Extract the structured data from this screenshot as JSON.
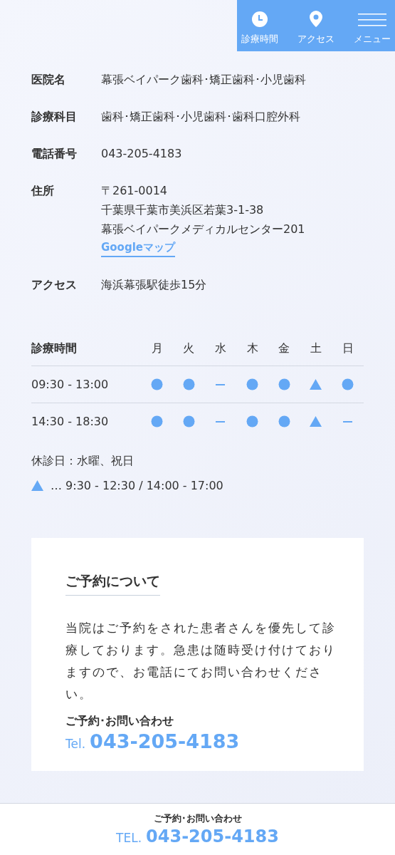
{
  "nav": [
    {
      "kind": "clock",
      "label": "診療時間"
    },
    {
      "kind": "pin",
      "label": "アクセス"
    },
    {
      "kind": "menu",
      "label": "メニュー"
    }
  ],
  "info": [
    {
      "label": "医院名",
      "lines": [
        "幕張ベイパーク歯科･矯正歯科･小児歯科"
      ]
    },
    {
      "label": "診療科目",
      "lines": [
        "歯科･矯正歯科･小児歯科･歯科口腔外科"
      ]
    },
    {
      "label": "電話番号",
      "lines": [
        "043-205-4183"
      ]
    },
    {
      "label": "住所",
      "lines": [
        "〒261-0014",
        "千葉県千葉市美浜区若葉3-1-38",
        "幕張ベイパークメディカルセンター201"
      ],
      "link": "Googleマップ"
    },
    {
      "label": "アクセス",
      "lines": [
        "海浜幕張駅徒歩15分"
      ]
    }
  ],
  "schedule": {
    "heading": "診療時間",
    "days": [
      "月",
      "火",
      "水",
      "木",
      "金",
      "土",
      "日"
    ],
    "rows": [
      {
        "time": "09:30 - 13:00",
        "marks": [
          {
            "kind": "circle"
          },
          {
            "kind": "circle"
          },
          {
            "kind": "dash"
          },
          {
            "kind": "circle"
          },
          {
            "kind": "circle"
          },
          {
            "kind": "triangle"
          },
          {
            "kind": "circle"
          }
        ]
      },
      {
        "time": "14:30 - 18:30",
        "marks": [
          {
            "kind": "circle"
          },
          {
            "kind": "circle"
          },
          {
            "kind": "dash"
          },
          {
            "kind": "circle"
          },
          {
            "kind": "circle"
          },
          {
            "kind": "triangle"
          },
          {
            "kind": "dash"
          }
        ]
      }
    ],
    "closed": "休診日：水曜、祝日",
    "triangle_note": "…  9:30 - 12:30 / 14:00 - 17:00"
  },
  "card": {
    "title": "ご予約について",
    "body": "当院はご予約をされた患者さんを優先して診療しております。急患は随時受け付けておりますので、お電話にてお問い合わせください。",
    "contact_label": "ご予約･お問い合わせ",
    "tel_prefix": "Tel.",
    "tel": "043-205-4183"
  },
  "footer": {
    "label": "ご予約･お問い合わせ",
    "tel_prefix": "TEL.",
    "tel": "043-205-4183"
  }
}
